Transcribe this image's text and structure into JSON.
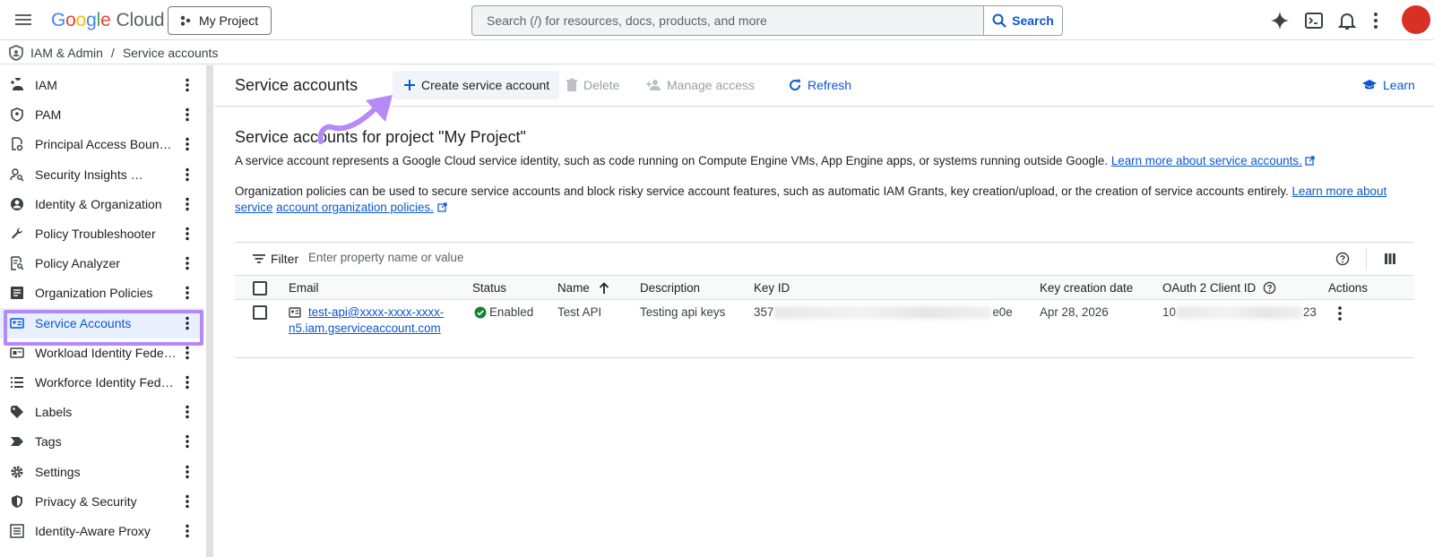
{
  "topbar": {
    "logo": {
      "g1": "G",
      "o1": "o",
      "o2": "o",
      "g2": "g",
      "l": "l",
      "e": "e",
      "cloud": "Cloud"
    },
    "project": "My Project",
    "search_placeholder": "Search (/) for resources, docs, products, and more",
    "search_button": "Search",
    "icons": [
      "menu-icon",
      "gemini-sparkle-icon",
      "cloud-shell-icon",
      "notifications-icon",
      "more-vert-icon"
    ],
    "avatar_color": "#d93025"
  },
  "breadcrumb": {
    "root": "IAM & Admin",
    "separator": "/",
    "current": "Service accounts"
  },
  "sidebar": {
    "items": [
      {
        "label": "IAM",
        "icon": "person-add-icon"
      },
      {
        "label": "PAM",
        "icon": "shield-person-icon"
      },
      {
        "label": "Principal Access Boun…",
        "icon": "policy-icon"
      },
      {
        "label": "Security Insights …",
        "icon": "person-search-icon"
      },
      {
        "label": "Identity & Organization",
        "icon": "account-circle-icon"
      },
      {
        "label": "Policy Troubleshooter",
        "icon": "wrench-icon"
      },
      {
        "label": "Policy Analyzer",
        "icon": "document-search-icon"
      },
      {
        "label": "Organization Policies",
        "icon": "article-icon"
      },
      {
        "label": "Service Accounts",
        "icon": "service-account-icon",
        "active": true
      },
      {
        "label": "Workload Identity Fede…",
        "icon": "id-card-icon"
      },
      {
        "label": "Workforce Identity Fed…",
        "icon": "list-icon"
      },
      {
        "label": "Labels",
        "icon": "label-icon"
      },
      {
        "label": "Tags",
        "icon": "tag-arrow-icon"
      },
      {
        "label": "Settings",
        "icon": "settings-gear-icon"
      },
      {
        "label": "Privacy & Security",
        "icon": "privacy-shield-icon"
      },
      {
        "label": "Identity-Aware Proxy",
        "icon": "proxy-icon"
      }
    ],
    "highlight_color": "#b58af5"
  },
  "toolbar": {
    "title": "Service accounts",
    "create": "Create service account",
    "delete": "Delete",
    "manage": "Manage access",
    "refresh": "Refresh",
    "learn": "Learn"
  },
  "content": {
    "heading": "Service accounts for project \"My Project\"",
    "para1": "A service account represents a Google Cloud service identity, such as code running on Compute Engine VMs, App Engine apps, or systems running outside Google.",
    "para1_link": "Learn more about service accounts.",
    "para2": "Organization policies can be used to secure service accounts and block risky service account features, such as automatic IAM Grants, key creation/upload, or the creation of service accounts entirely.",
    "para2_link_a": "Learn more about service",
    "para2_link_b": "account organization policies."
  },
  "filter": {
    "label": "Filter",
    "placeholder": "Enter property name or value"
  },
  "table": {
    "headers": [
      "Email",
      "Status",
      "Name",
      "Description",
      "Key ID",
      "Key creation date",
      "OAuth 2 Client ID",
      "Actions"
    ],
    "rows": [
      {
        "email_line1": "test-api@xxxx-xxxx-xxxx-",
        "email_line2": "n5.iam.gserviceaccount.com",
        "status": "Enabled",
        "name": "Test API",
        "description": "Testing api keys",
        "key_prefix": "357",
        "key_suffix": "e0e",
        "key_date": "Apr 28, 2026",
        "client_prefix": "10",
        "client_suffix": "23"
      }
    ]
  },
  "colors": {
    "accent": "#0b57d0",
    "enabled": "#188038",
    "arrow": "#b58af5"
  }
}
